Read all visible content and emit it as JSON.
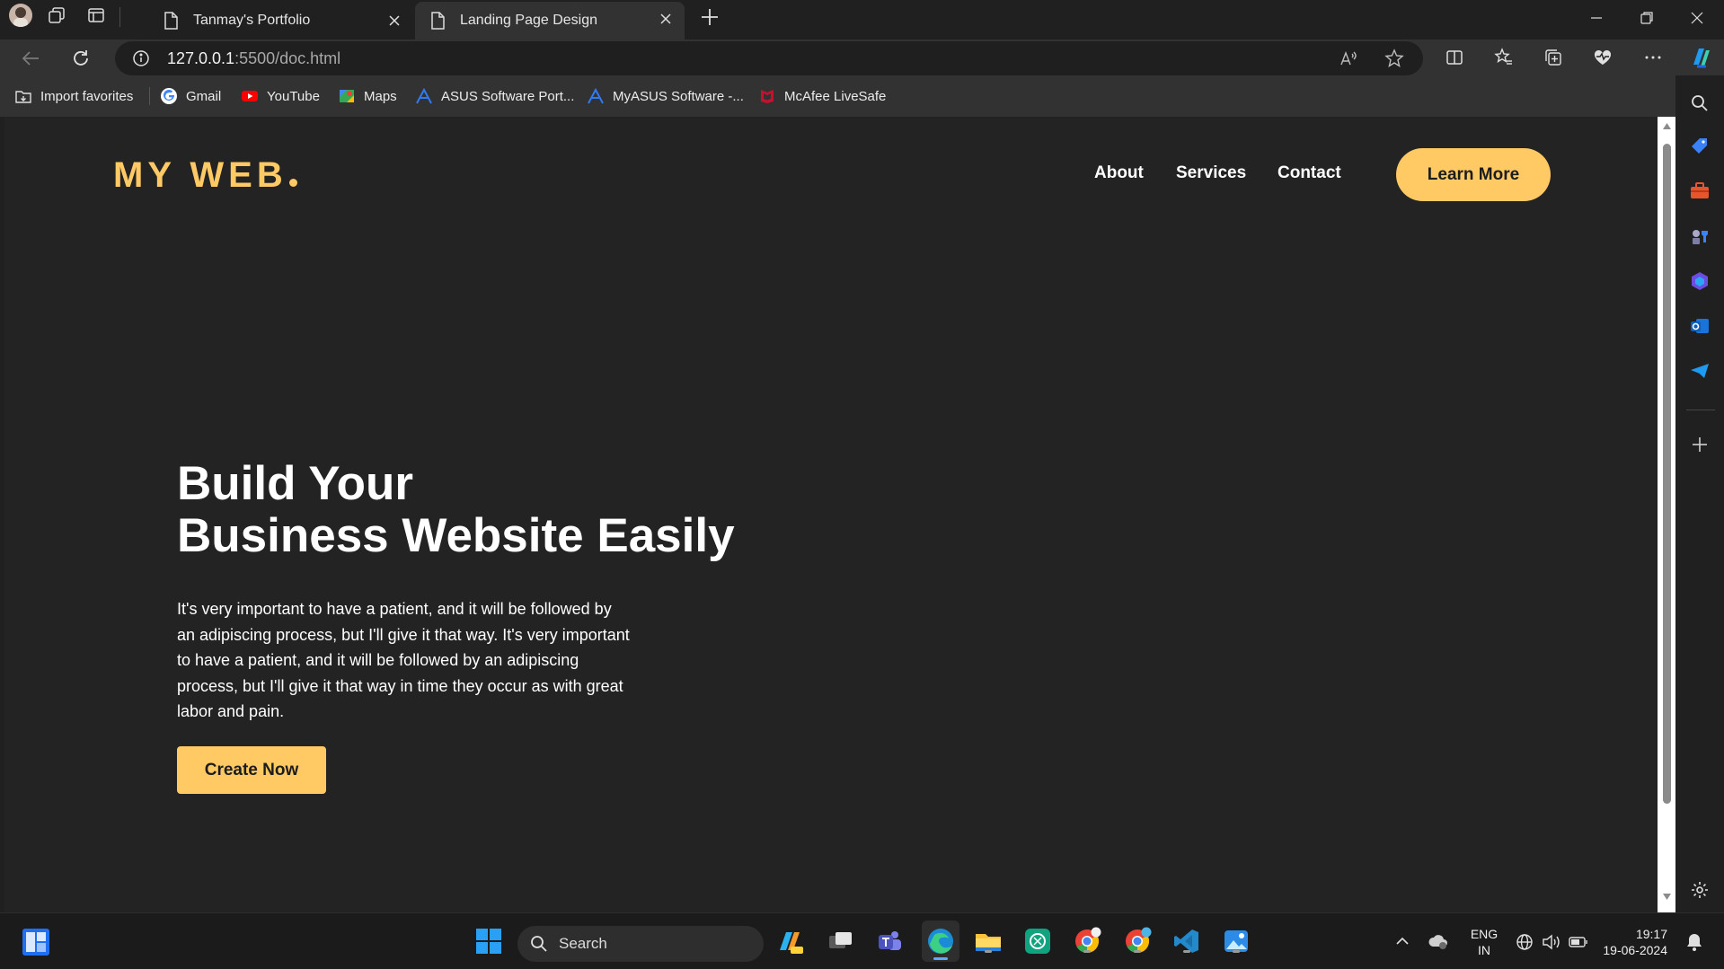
{
  "browser": {
    "tabs": [
      {
        "label": "Tanmay's Portfolio"
      },
      {
        "label": "Landing Page Design"
      }
    ],
    "address": {
      "host": "127.0.0.1",
      "path": ":5500/doc.html"
    },
    "favorites": [
      {
        "label": "Import favorites",
        "icon": "import-favorites-icon"
      },
      {
        "label": "Gmail",
        "icon": "google-icon"
      },
      {
        "label": "YouTube",
        "icon": "youtube-icon"
      },
      {
        "label": "Maps",
        "icon": "maps-icon"
      },
      {
        "label": "ASUS Software Port...",
        "icon": "asus-icon"
      },
      {
        "label": "MyASUS Software -...",
        "icon": "asus-icon"
      },
      {
        "label": "McAfee LiveSafe",
        "icon": "mcafee-icon"
      }
    ],
    "colors": {
      "chrome": "#202020",
      "toolbar": "#323232",
      "accent_blue": "#3b82f6"
    }
  },
  "page": {
    "logo": "MY WEB",
    "nav": [
      {
        "label": "About"
      },
      {
        "label": "Services"
      },
      {
        "label": "Contact"
      }
    ],
    "cta_top": "Learn More",
    "hero": {
      "title_line1": "Build Your",
      "title_line2": "Business Website Easily",
      "text_lines": [
        "It's very important to have a patient, and it will be followed by",
        "an adipiscing process, but I'll give it that way. It's very important",
        "to have a patient, and it will be followed by an adipiscing",
        "process, but I'll give it that way in time they occur as with great",
        "labor and pain."
      ],
      "cta": "Create Now"
    },
    "colors": {
      "background": "#232323",
      "accent": "#ffc964",
      "text": "#ffffff"
    }
  },
  "taskbar": {
    "search_placeholder": "Search",
    "language": {
      "line1": "ENG",
      "line2": "IN"
    },
    "time": "19:17",
    "date": "19-06-2024"
  }
}
